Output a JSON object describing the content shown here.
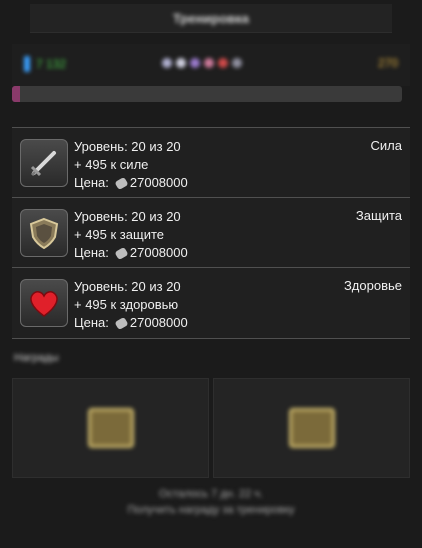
{
  "header": {
    "title": "Тренировка"
  },
  "status": {
    "left_value": "7 132",
    "right_value": "270",
    "progress": 0.02
  },
  "upgrades": [
    {
      "level": "Уровень: 20 из 20",
      "bonus": "+ 495 к силе",
      "price_label": "Цена:",
      "price": "27008000",
      "name": "Сила",
      "icon": "sword-icon"
    },
    {
      "level": "Уровень: 20 из 20",
      "bonus": "+ 495 к защите",
      "price_label": "Цена:",
      "price": "27008000",
      "name": "Защита",
      "icon": "shield-icon"
    },
    {
      "level": "Уровень: 20 из 20",
      "bonus": "+ 495 к здоровью",
      "price_label": "Цена:",
      "price": "27008000",
      "name": "Здоровье",
      "icon": "heart-icon"
    }
  ],
  "section": {
    "label": "Награды"
  },
  "footer": {
    "line1": "Осталось 7 дн. 22 ч.",
    "line2": "Получить награду за тренировку"
  }
}
